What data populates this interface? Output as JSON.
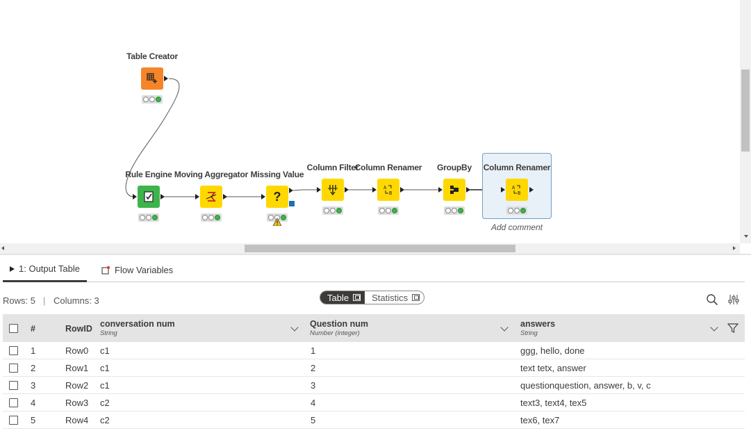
{
  "workflow": {
    "nodes": [
      {
        "id": "table-creator",
        "title": "Table Creator",
        "color": "#f6852a"
      },
      {
        "id": "rule-engine",
        "title": "Rule Engine",
        "color": "#3cb44b"
      },
      {
        "id": "moving-aggregator",
        "title": "Moving Aggregator",
        "color": "#ffd800"
      },
      {
        "id": "missing-value",
        "title": "Missing Value",
        "color": "#ffd800"
      },
      {
        "id": "column-filter",
        "title": "Column Filter",
        "color": "#ffd800"
      },
      {
        "id": "column-renamer-1",
        "title": "Column Renamer",
        "color": "#ffd800"
      },
      {
        "id": "groupby",
        "title": "GroupBy",
        "color": "#ffd800"
      },
      {
        "id": "column-renamer-2",
        "title": "Column Renamer",
        "color": "#ffd800",
        "selected": true
      }
    ],
    "add_comment": "Add comment"
  },
  "tabs": {
    "output_table": "1: Output Table",
    "flow_variables": "Flow Variables"
  },
  "info": {
    "rows": "Rows: 5",
    "columns": "Columns: 3"
  },
  "view_toggle": {
    "table": "Table",
    "statistics": "Statistics"
  },
  "table": {
    "headers": {
      "index": "#",
      "rowid": "RowID",
      "col1_name": "conversation num",
      "col1_type": "String",
      "col2_name": "Question num",
      "col2_type": "Number (integer)",
      "col3_name": "answers",
      "col3_type": "String"
    },
    "rows": [
      {
        "index": "1",
        "rowid": "Row0",
        "conv": "c1",
        "q": "1",
        "answers": "ggg, hello, done"
      },
      {
        "index": "2",
        "rowid": "Row1",
        "conv": "c1",
        "q": "2",
        "answers": "text tetx, answer"
      },
      {
        "index": "3",
        "rowid": "Row2",
        "conv": "c1",
        "q": "3",
        "answers": "questionquestion, answer, b, v, c"
      },
      {
        "index": "4",
        "rowid": "Row3",
        "conv": "c2",
        "q": "4",
        "answers": "text3, text4, tex5"
      },
      {
        "index": "5",
        "rowid": "Row4",
        "conv": "c2",
        "q": "5",
        "answers": "tex6, tex7"
      }
    ]
  },
  "icons": [
    "table-creator-icon",
    "rule-engine-icon",
    "moving-aggregator-icon",
    "missing-value-icon",
    "column-filter-icon",
    "column-renamer-icon",
    "groupby-icon",
    "flow-variables-icon",
    "search-icon",
    "settings-icon",
    "filter-icon",
    "warning-icon"
  ]
}
